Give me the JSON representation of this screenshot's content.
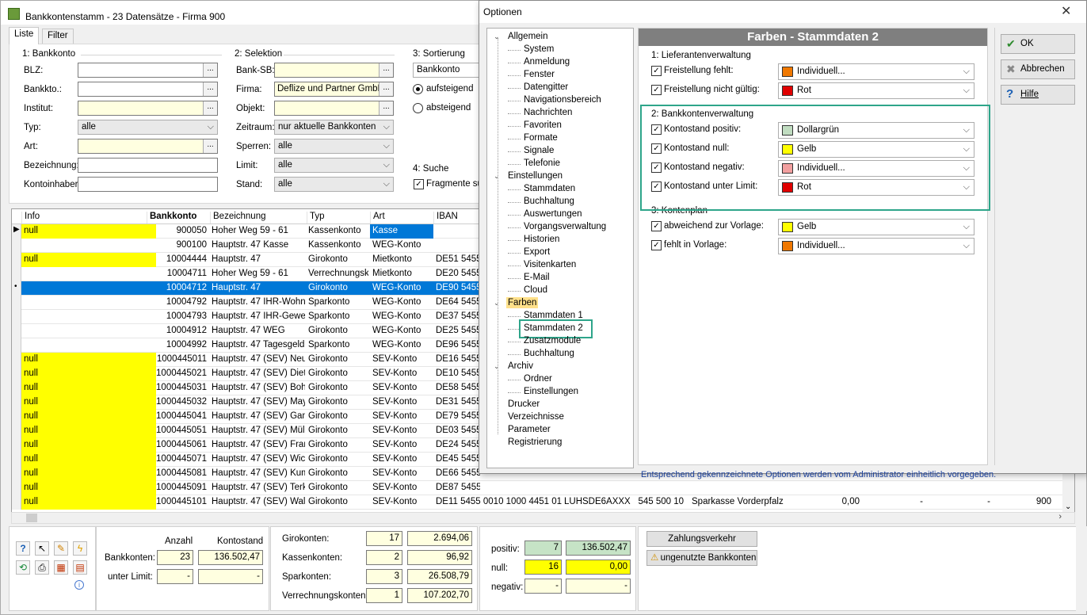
{
  "main_window": {
    "title": "Bankkontenstamm - 23 Datensätze - Firma 900",
    "tabs": [
      "Liste",
      "Filter"
    ]
  },
  "bankkonto_group": {
    "title": "1: Bankkonto",
    "labels": [
      "BLZ:",
      "Bankkto.:",
      "Institut:",
      "Typ:",
      "Art:",
      "Bezeichnung:",
      "Kontoinhaber:"
    ],
    "typ_value": "alle"
  },
  "selektion_group": {
    "title": "2: Selektion",
    "labels": [
      "Bank-SB:",
      "Firma:",
      "Objekt:",
      "Zeitraum:",
      "Sperren:",
      "Limit:",
      "Stand:"
    ],
    "firma_value": "Deflize und Partner GmbH",
    "zeitraum_value": "nur aktuelle Bankkonten",
    "sperren_value": "alle",
    "limit_value": "alle",
    "stand_value": "alle"
  },
  "sortierung_group": {
    "title": "3: Sortierung",
    "value": "Bankkonto",
    "asc": "aufsteigend",
    "desc": "absteigend"
  },
  "suche_group": {
    "title": "4: Suche",
    "fragment": "Fragmente suc"
  },
  "grid": {
    "headers": [
      "Info",
      "Bankkonto",
      "Bezeichnung",
      "Typ",
      "Art",
      "IBAN"
    ],
    "rows": [
      {
        "info": "null",
        "konto": "900050",
        "bez": "Hoher Weg 59 - 61",
        "typ": "Kassenkonto",
        "art": "Kasse",
        "iban": ""
      },
      {
        "info": "",
        "konto": "900100",
        "bez": "Hauptstr. 47 Kasse",
        "typ": "Kassenkonto",
        "art": "WEG-Konto",
        "iban": ""
      },
      {
        "info": "null",
        "konto": "10004444",
        "bez": "Hauptstr. 47",
        "typ": "Girokonto",
        "art": "Mietkonto",
        "iban": "DE51 5455"
      },
      {
        "info": "",
        "konto": "10004711",
        "bez": "Hoher Weg 59 - 61",
        "typ": "Verrechnungskc",
        "art": "Mietkonto",
        "iban": "DE20 5455"
      },
      {
        "info": "",
        "konto": "10004712",
        "bez": "Hauptstr. 47",
        "typ": "Girokonto",
        "art": "WEG-Konto",
        "iban": "DE90 5455"
      },
      {
        "info": "",
        "konto": "10004792",
        "bez": "Hauptstr. 47 IHR-Wohnu",
        "typ": "Sparkonto",
        "art": "WEG-Konto",
        "iban": "DE64 5455"
      },
      {
        "info": "",
        "konto": "10004793",
        "bez": "Hauptstr. 47 IHR-Gewerb",
        "typ": "Sparkonto",
        "art": "WEG-Konto",
        "iban": "DE37 5455"
      },
      {
        "info": "",
        "konto": "10004912",
        "bez": "Hauptstr. 47 WEG",
        "typ": "Girokonto",
        "art": "WEG-Konto",
        "iban": "DE25 5455"
      },
      {
        "info": "",
        "konto": "10004992",
        "bez": "Hauptstr. 47 Tagesgeld I",
        "typ": "Sparkonto",
        "art": "WEG-Konto",
        "iban": "DE96 5455"
      },
      {
        "info": "null",
        "konto": "1000445011",
        "bez": "Hauptstr. 47 (SEV) Neum",
        "typ": "Girokonto",
        "art": "SEV-Konto",
        "iban": "DE16 5455"
      },
      {
        "info": "null",
        "konto": "1000445021",
        "bez": "Hauptstr. 47 (SEV) Dietz",
        "typ": "Girokonto",
        "art": "SEV-Konto",
        "iban": "DE10 5455"
      },
      {
        "info": "null",
        "konto": "1000445031",
        "bez": "Hauptstr. 47 (SEV) Bohn",
        "typ": "Girokonto",
        "art": "SEV-Konto",
        "iban": "DE58 5455"
      },
      {
        "info": "null",
        "konto": "1000445032",
        "bez": "Hauptstr. 47 (SEV) Maye",
        "typ": "Girokonto",
        "art": "SEV-Konto",
        "iban": "DE31 5455"
      },
      {
        "info": "null",
        "konto": "1000445041",
        "bez": "Hauptstr. 47 (SEV) Gans",
        "typ": "Girokonto",
        "art": "SEV-Konto",
        "iban": "DE79 5455"
      },
      {
        "info": "null",
        "konto": "1000445051",
        "bez": "Hauptstr. 47 (SEV) Mülle",
        "typ": "Girokonto",
        "art": "SEV-Konto",
        "iban": "DE03 5455"
      },
      {
        "info": "null",
        "konto": "1000445061",
        "bez": "Hauptstr. 47 (SEV) Frank",
        "typ": "Girokonto",
        "art": "SEV-Konto",
        "iban": "DE24 5455"
      },
      {
        "info": "null",
        "konto": "1000445071",
        "bez": "Hauptstr. 47 (SEV) Wich",
        "typ": "Girokonto",
        "art": "SEV-Konto",
        "iban": "DE45 5455"
      },
      {
        "info": "null",
        "konto": "1000445081",
        "bez": "Hauptstr. 47 (SEV) Kumn",
        "typ": "Girokonto",
        "art": "SEV-Konto",
        "iban": "DE66 5455"
      },
      {
        "info": "null",
        "konto": "1000445091",
        "bez": "Hauptstr. 47 (SEV) Terka",
        "typ": "Girokonto",
        "art": "SEV-Konto",
        "iban": "DE87 5455"
      },
      {
        "info": "null",
        "konto": "1000445101",
        "bez": "Hauptstr. 47 (SEV) Wald",
        "typ": "Girokonto",
        "art": "SEV-Konto",
        "iban": "DE11 5455 0010 1000 4451 01"
      }
    ],
    "last_row_extra": {
      "bic": "LUHSDE6AXXX",
      "blz": "545 500 10",
      "bank": "Sparkasse Vorderpfalz",
      "saldo": "0,00",
      "dash1": "-",
      "dash2": "-",
      "firma": "900"
    }
  },
  "summary": {
    "col_anzahl": "Anzahl",
    "col_kontostand": "Kontostand",
    "bankkonten_label": "Bankkonten:",
    "bankkonten_anzahl": "23",
    "bankkonten_stand": "136.502,47",
    "unterlimit_label": "unter Limit:",
    "unterlimit_anzahl": "-",
    "unterlimit_stand": "-",
    "types": [
      {
        "label": "Girokonten:",
        "count": "17",
        "sum": "2.694,06"
      },
      {
        "label": "Kassenkonten:",
        "count": "2",
        "sum": "96,92"
      },
      {
        "label": "Sparkonten:",
        "count": "3",
        "sum": "26.508,79"
      },
      {
        "label": "Verrechnungskonten:",
        "count": "1",
        "sum": "107.202,70"
      }
    ],
    "positiv_label": "positiv:",
    "positiv_count": "7",
    "positiv_sum": "136.502,47",
    "null_label": "null:",
    "null_count": "16",
    "null_sum": "0,00",
    "negativ_label": "negativ:",
    "negativ_count": "-",
    "negativ_sum": "-",
    "zahlungsverkehr": "Zahlungsverkehr",
    "ungenutzte": "ungenutzte Bankkonten"
  },
  "dialog": {
    "title": "Optionen",
    "heading": "Farben - Stammdaten 2",
    "ok": "OK",
    "cancel": "Abbrechen",
    "help": "Hilfe",
    "footer_note": "Entsprechend gekennzeichnete Optionen werden vom Administrator einheitlich vorgegeben.",
    "tree": {
      "allgemein": "Allgemein",
      "allgemein_children": [
        "System",
        "Anmeldung",
        "Fenster",
        "Datengitter",
        "Navigationsbereich",
        "Nachrichten",
        "Favoriten",
        "Formate",
        "Signale",
        "Telefonie"
      ],
      "einstellungen": "Einstellungen",
      "einstellungen_children": [
        "Stammdaten",
        "Buchhaltung",
        "Auswertungen",
        "Vorgangsverwaltung",
        "Historien",
        "Export",
        "Visitenkarten",
        "E-Mail",
        "Cloud"
      ],
      "farben": "Farben",
      "farben_children": [
        "Stammdaten 1",
        "Stammdaten 2",
        "Zusatzmodule",
        "Buchhaltung"
      ],
      "archiv": "Archiv",
      "archiv_children": [
        "Ordner",
        "Einstellungen"
      ],
      "roots": [
        "Drucker",
        "Verzeichnisse",
        "Parameter",
        "Registrierung"
      ]
    },
    "groups": [
      {
        "title": "1: Lieferantenverwaltung",
        "items": [
          {
            "label": "Freistellung fehlt:",
            "value": "Individuell...",
            "color": "#f07800"
          },
          {
            "label": "Freistellung nicht gültig:",
            "value": "Rot",
            "color": "#e00000"
          }
        ]
      },
      {
        "title": "2: Bankkontenverwaltung",
        "items": [
          {
            "label": "Kontostand positiv:",
            "value": "Dollargrün",
            "color": "#c0dcc0"
          },
          {
            "label": "Kontostand null:",
            "value": "Gelb",
            "color": "#ffff00"
          },
          {
            "label": "Kontostand negativ:",
            "value": "Individuell...",
            "color": "#f2a0a0"
          },
          {
            "label": "Kontostand unter Limit:",
            "value": "Rot",
            "color": "#e00000"
          }
        ]
      },
      {
        "title": "3: Kontenplan",
        "items": [
          {
            "label": "abweichend zur Vorlage:",
            "value": "Gelb",
            "color": "#ffff00"
          },
          {
            "label": "fehlt in Vorlage:",
            "value": "Individuell...",
            "color": "#f07800"
          }
        ]
      }
    ]
  }
}
